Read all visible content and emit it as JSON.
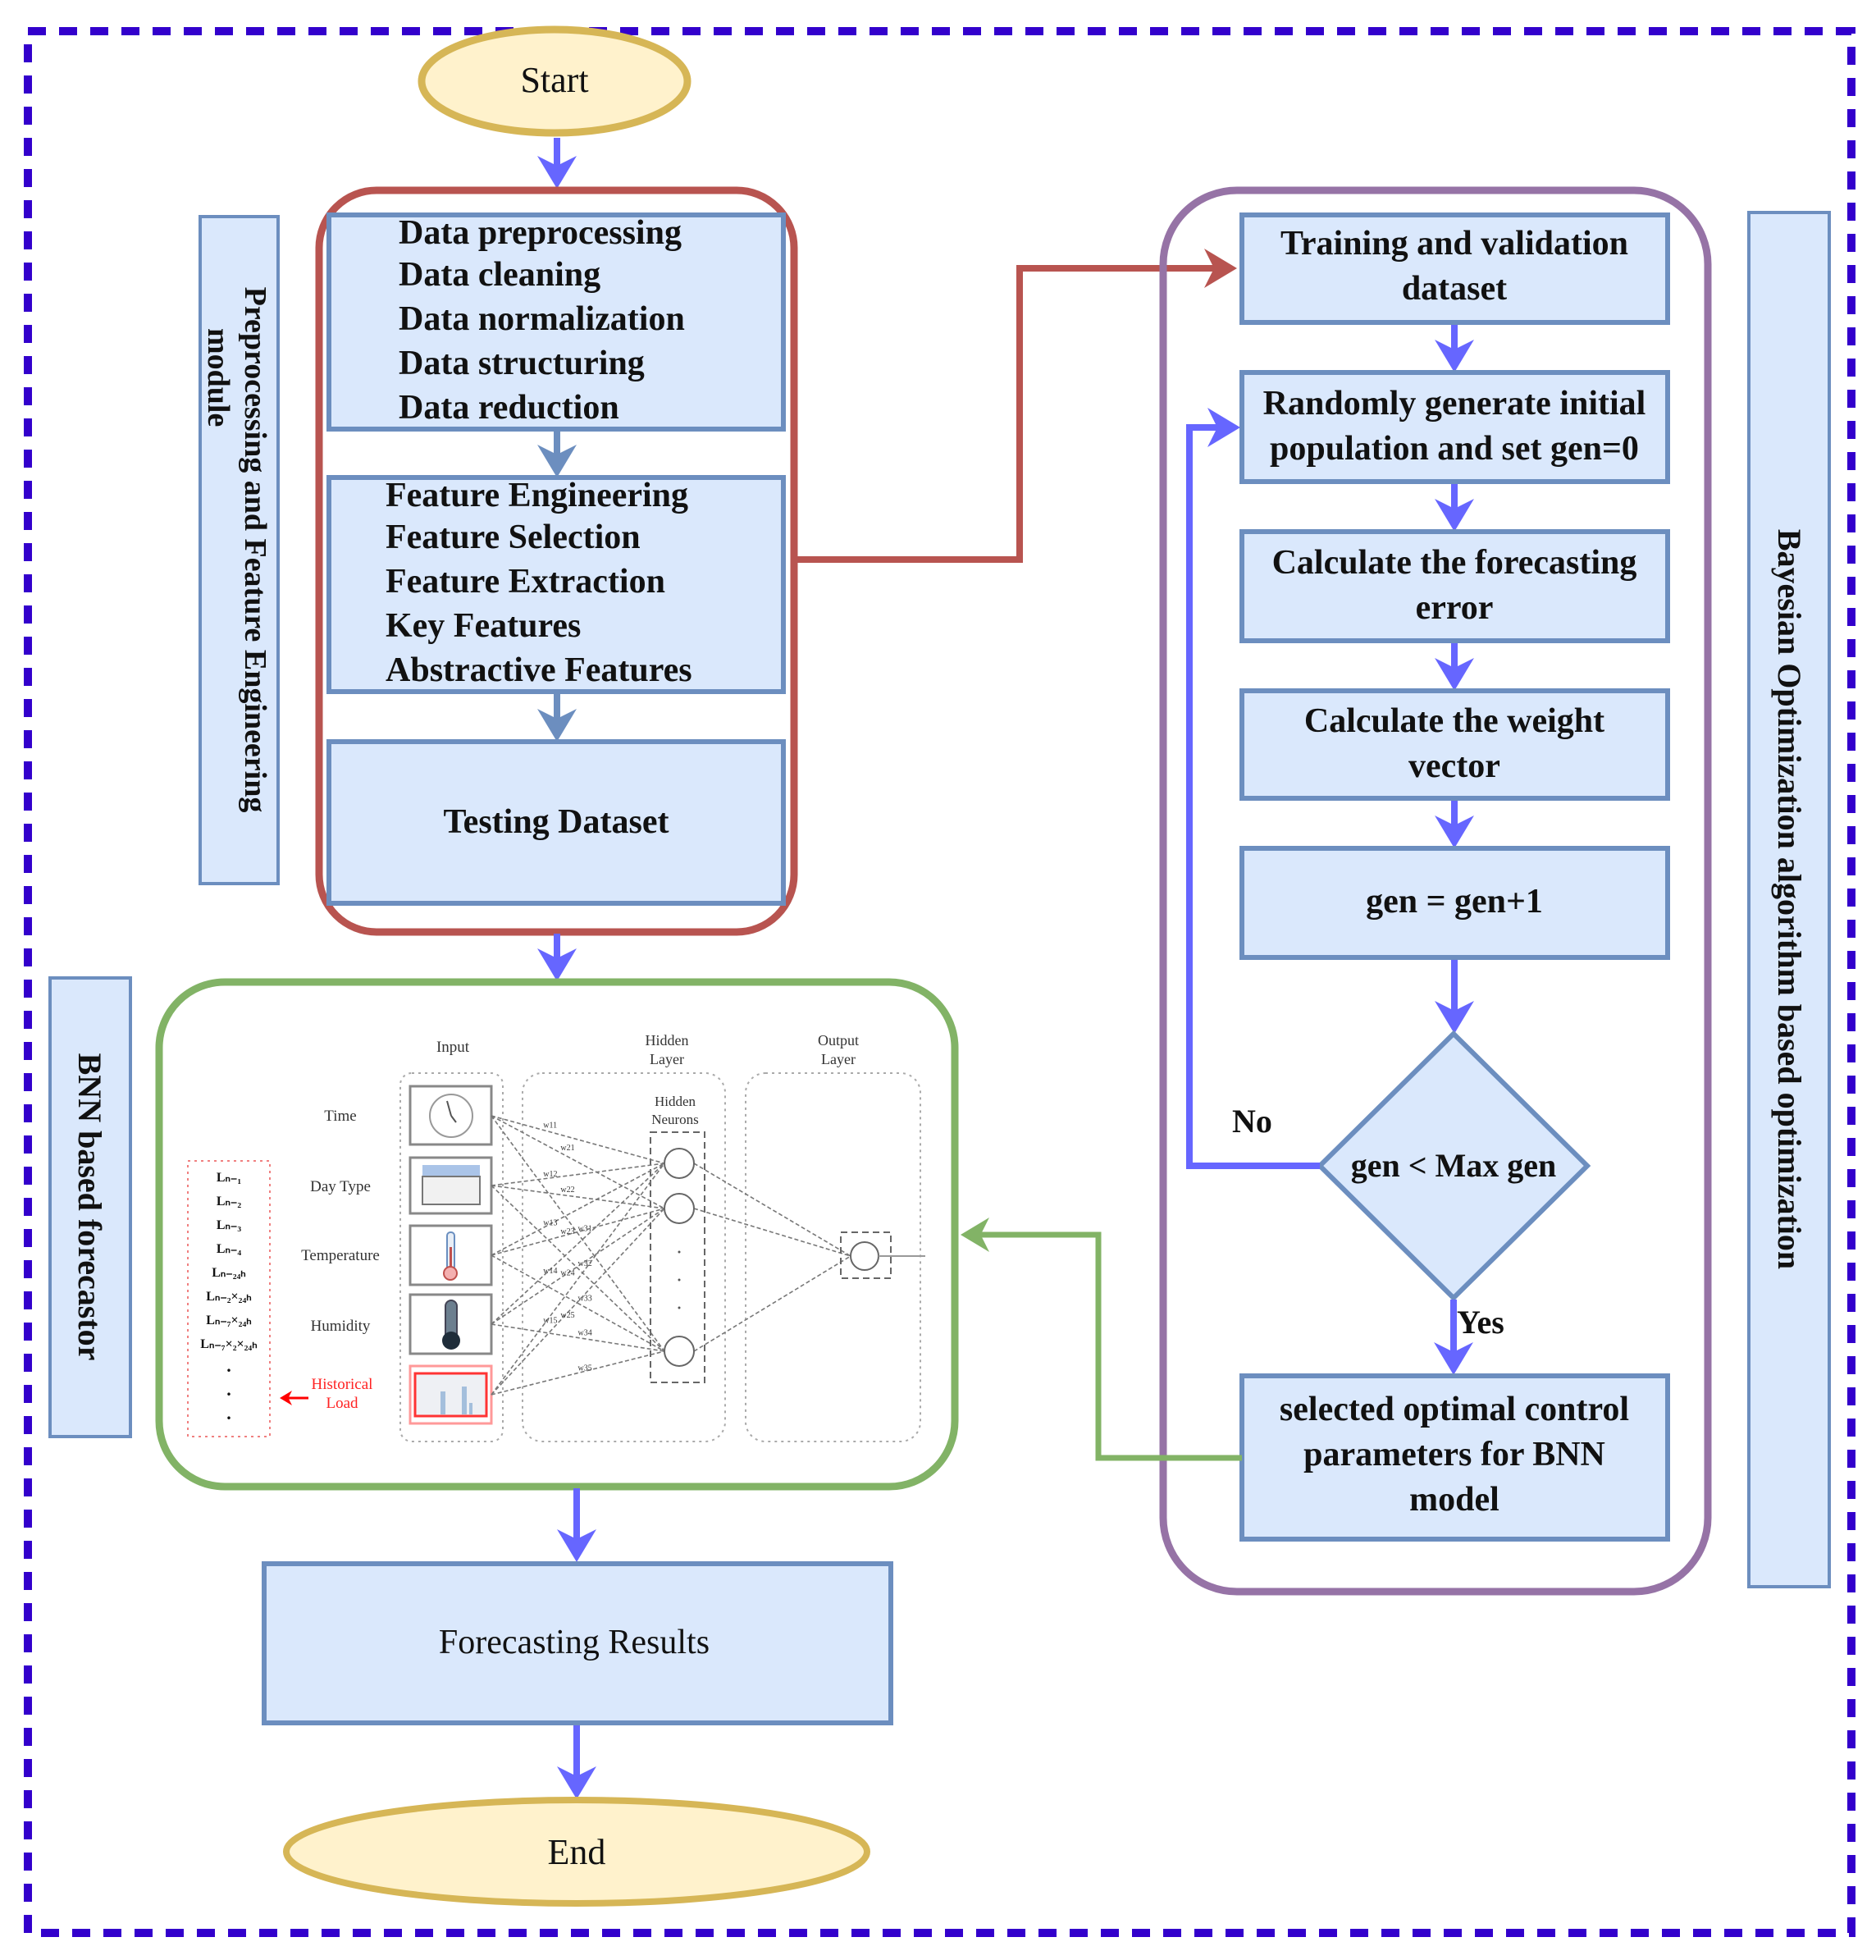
{
  "colors": {
    "outer_border": "#3300cc",
    "flow_arrow": "#6666ff",
    "box_fill": "#dae8fc",
    "box_stroke": "#6c8ebf",
    "terminal_fill": "#fff2cc",
    "terminal_stroke": "#d6b656",
    "preprocessing_group": "#b85450",
    "optimization_group": "#9673a6",
    "forecaster_group": "#82b366",
    "historical_load": "#ff0000"
  },
  "start": "Start",
  "end": "End",
  "preprocessing": {
    "side_label_line1": "Preprocessing and Feature Engineering",
    "side_label_line2": "module",
    "data_box": [
      "Data preprocessing",
      "Data cleaning",
      "Data normalization",
      "Data structuring",
      "Data reduction"
    ],
    "feature_box": [
      "Feature Engineering",
      "Feature Selection",
      "Feature Extraction",
      "Key Features",
      "Abstractive Features"
    ],
    "testing": "Testing Dataset"
  },
  "optimization": {
    "side_label": "Bayesian Optimization algorithm based optimization",
    "training": [
      "Training and validation",
      "dataset"
    ],
    "random_init": [
      "Randomly generate initial",
      "population and set gen=0"
    ],
    "calc_error": [
      "Calculate the forecasting",
      "error"
    ],
    "calc_weight": [
      "Calculate the weight",
      "vector"
    ],
    "gen_increment": "gen = gen+1",
    "decision": "gen < Max gen",
    "no_label": "No",
    "yes_label": "Yes",
    "selected": [
      "selected optimal control",
      "parameters for BNN",
      "model"
    ]
  },
  "forecaster": {
    "side_label": "BNN based forecastor",
    "network": {
      "input_title": "Input",
      "hidden_title": [
        "Hidden",
        "Layer"
      ],
      "hidden_neurons_title": [
        "Hidden",
        "Neurons"
      ],
      "output_title": [
        "Output",
        "Layer"
      ],
      "inputs": [
        "Time",
        "Day Type",
        "Temperature",
        "Humidity"
      ],
      "historical": [
        "Historical",
        "Load"
      ],
      "lags": [
        "Lₙ₋₁",
        "Lₙ₋₂",
        "Lₙ₋₃",
        "Lₙ₋₄",
        "Lₙ₋₂₄ₕ",
        "Lₙ₋₂×₂₄ₕ",
        "Lₙ₋₇×₂₄ₕ",
        "Lₙ₋₇×₂×₂₄ₕ",
        ".",
        ".",
        "."
      ],
      "weight_label": "w"
    }
  },
  "results": "Forecasting Results"
}
